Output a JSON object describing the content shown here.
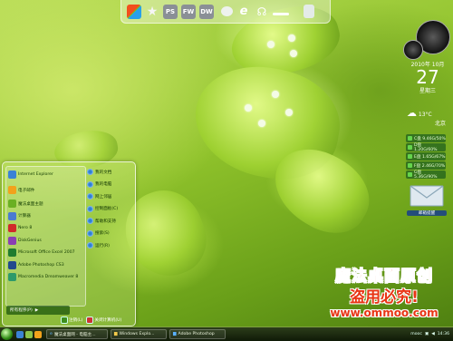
{
  "dock": {
    "icons": [
      {
        "name": "windows-logo-icon",
        "label": ""
      },
      {
        "name": "star-icon",
        "label": ""
      },
      {
        "name": "photoshop-icon",
        "label": "PS"
      },
      {
        "name": "fireworks-icon",
        "label": "FW"
      },
      {
        "name": "dreamweaver-icon",
        "label": "DW"
      },
      {
        "name": "chat-icon",
        "label": ""
      },
      {
        "name": "ie-icon",
        "label": ""
      },
      {
        "name": "headphones-icon",
        "label": ""
      },
      {
        "name": "minus-icon",
        "label": ""
      },
      {
        "name": "recycle-bin-icon",
        "label": ""
      }
    ]
  },
  "clock": {
    "year_month": "2010年 10月",
    "day": "27",
    "weekday": "星期三"
  },
  "weather": {
    "temp": "13°C",
    "city": "北京"
  },
  "drives": [
    {
      "label": "C盘 9.46G/50%"
    },
    {
      "label": "D盘 1.20G/60%"
    },
    {
      "label": "E盘 1.65G/67%"
    },
    {
      "label": "F盘 2.46G/70%"
    },
    {
      "label": "G盘 5.36G/90%"
    }
  ],
  "mail": {
    "label": "邮箱提醒"
  },
  "start_menu": {
    "pinned": [
      {
        "label": "Internet Explorer",
        "color": "#3b82d6"
      },
      {
        "label": "电子邮件",
        "color": "#f2a21b"
      }
    ],
    "recent": [
      {
        "label": "魔法桌面主题",
        "color": "#6ab023"
      },
      {
        "label": "计算器",
        "color": "#4a7bd0"
      },
      {
        "label": "Nero 8",
        "color": "#d02a2a"
      },
      {
        "label": "DiskGenius",
        "color": "#8a3fb3"
      },
      {
        "label": "Microsoft Office Excel 2007",
        "color": "#207c2f"
      },
      {
        "label": "Adobe Photoshop CS3",
        "color": "#214a8d"
      },
      {
        "label": "Macromedia Dreamweaver 8",
        "color": "#2e9a6a"
      }
    ],
    "all_programs": "所有程序(P)",
    "right": [
      {
        "label": "我的文档"
      },
      {
        "label": "我的电脑"
      },
      {
        "label": "网上邻居"
      },
      {
        "label": "控制面板(C)"
      },
      {
        "label": "帮助和支持"
      },
      {
        "label": "搜索(S)"
      },
      {
        "label": "运行(R)"
      }
    ],
    "logoff": "注销(L)",
    "shutdown": "关闭计算机(U)"
  },
  "taskbar": {
    "tasks": [
      {
        "label": "魔法桌面网 - 电脑主..."
      },
      {
        "label": "Windows Explo..."
      },
      {
        "label": "Adobe Photoshop"
      }
    ],
    "tray_text": "mooc",
    "time": "14:36"
  },
  "watermark": {
    "line1": "魔法桌面原创",
    "line2": "盗用必究!",
    "line3": "www.ommoo.com"
  }
}
